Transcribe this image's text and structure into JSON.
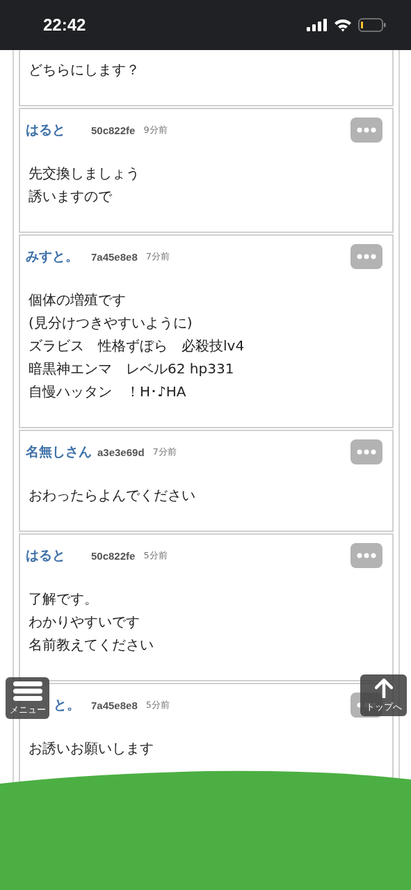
{
  "status_bar": {
    "time": "22:42"
  },
  "posts": [
    {
      "lines": [
        "どちらにします？"
      ]
    },
    {
      "name": "はると",
      "id": "50c822fe",
      "time": "9分前",
      "lines": [
        "先交換しましょう",
        "誘いますので"
      ]
    },
    {
      "name": "みすと。",
      "id": "7a45e8e8",
      "time": "7分前",
      "lines": [
        "個体の増殖です",
        "(見分けつきやすいように)",
        "ズラビス　性格ずぼら　必殺技lv4",
        "暗黒神エンマ　レベル62 hp331",
        "自慢ハッタン　！H･♪HA"
      ]
    },
    {
      "name": "名無しさん",
      "id": "a3e3e69d",
      "time": "7分前",
      "lines": [
        "おわったらよんでください"
      ]
    },
    {
      "name": "はると",
      "id": "50c822fe",
      "time": "5分前",
      "lines": [
        "了解です。",
        "わかりやすいです",
        "名前教えてください"
      ]
    },
    {
      "name": "と。",
      "name_covered": true,
      "id": "7a45e8e8",
      "time": "5分前",
      "lines": [
        "お誘いお願いします"
      ]
    }
  ],
  "menu_button": {
    "label": "メニュー"
  },
  "top_button": {
    "label": "トップへ"
  }
}
